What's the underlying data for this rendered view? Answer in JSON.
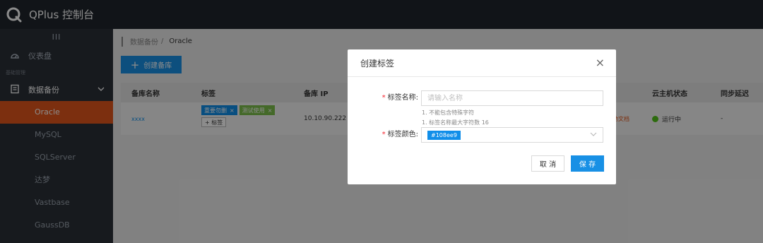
{
  "app": {
    "title": "QPlus 控制台"
  },
  "sidebar": {
    "collapse_glyph": "III",
    "dashboard_label": "仪表盘",
    "section_label": "基础管理",
    "group_label": "数据备份",
    "items": [
      {
        "label": "Oracle",
        "active": true
      },
      {
        "label": "MySQL"
      },
      {
        "label": "SQLServer"
      },
      {
        "label": "达梦"
      },
      {
        "label": "Vastbase"
      },
      {
        "label": "GaussDB"
      }
    ]
  },
  "breadcrumb": {
    "parent": "数据备份",
    "separator": "/",
    "current": "Oracle"
  },
  "toolbar": {
    "create_label": "创建备库"
  },
  "table": {
    "headers": {
      "name": "备库名称",
      "tags": "标签",
      "ip": "备库 IP",
      "host_status": "云主机状态",
      "sync_delay": "同步延迟"
    },
    "row": {
      "name": "xxxx",
      "tags": [
        "重要勿删",
        "测试使用"
      ],
      "tag_close": "×",
      "add_tag": "+ 标签",
      "ip": "10.10.90.222",
      "doc_link": "手动文档",
      "host_status": "运行中",
      "sync_delay": "-"
    }
  },
  "modal": {
    "title": "创建标签",
    "close_glyph": "×",
    "name_label": "标签名称:",
    "name_placeholder": "请输入名称",
    "hint_1": "1. 不能包含特殊字符",
    "hint_2": "1. 标签名称最大字符数 16",
    "color_label": "标签颜色:",
    "color_value": "#108ee9",
    "required_mark": "*",
    "cancel_label": "取 消",
    "save_label": "保 存"
  },
  "colors": {
    "accent": "#1890e5",
    "active_nav": "#e2571c",
    "tag_blue": "#108ee9",
    "tag_green": "#7dbf4c",
    "status_green": "#52c41a"
  }
}
